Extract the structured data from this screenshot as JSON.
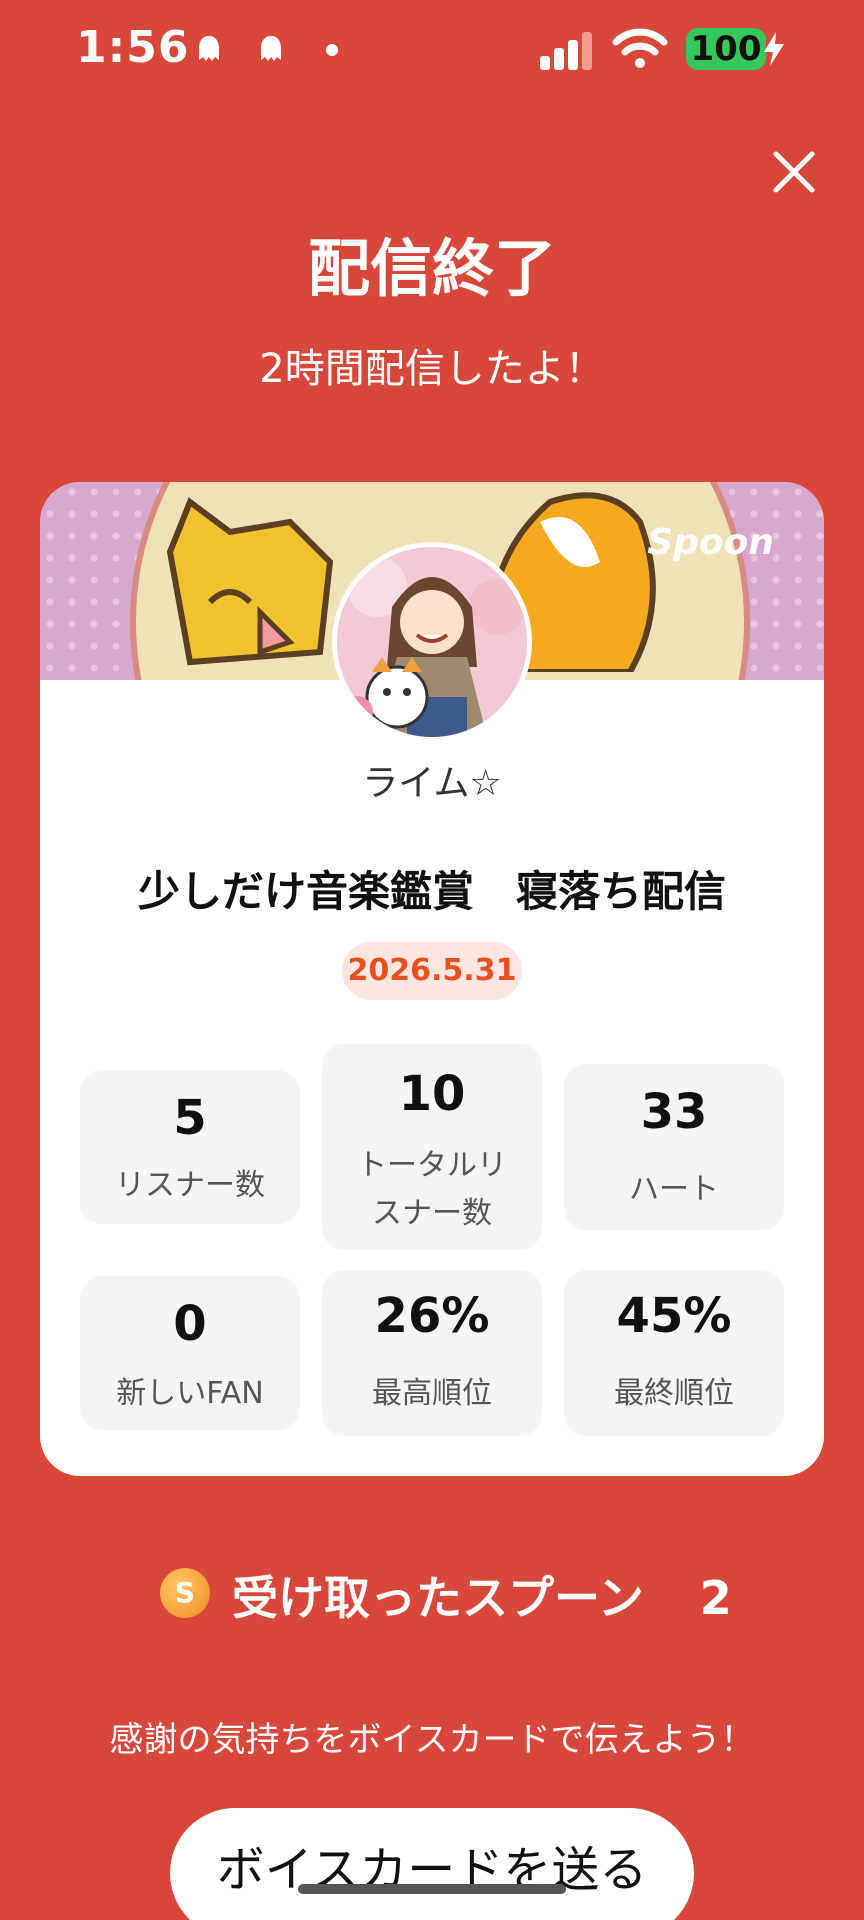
{
  "status_bar": {
    "time": "1:56",
    "battery": "100",
    "icons": [
      "ghost-notification-icon",
      "ghost-notification-icon",
      "dot-icon",
      "signal-icon",
      "wifi-icon",
      "battery-icon",
      "charging-bolt-icon"
    ]
  },
  "header": {
    "title": "配信終了",
    "subtitle": "2時間配信したよ！"
  },
  "card": {
    "brand": "Spoon",
    "username": "ライム☆",
    "broadcast_title": "少しだけ音楽鑑賞　寝落ち配信",
    "date": "2026.5.31",
    "stats": [
      {
        "value": "5",
        "label": "リスナー数"
      },
      {
        "value": "10",
        "label_line1": "トータルリ",
        "label_line2": "スナー数"
      },
      {
        "value": "33",
        "label": "ハート"
      },
      {
        "value": "0",
        "label": "新しいFAN"
      },
      {
        "value": "26%",
        "label": "最高順位"
      },
      {
        "value": "45%",
        "label": "最終順位"
      }
    ]
  },
  "spoons": {
    "coin_letter": "S",
    "label": "受け取ったスプーン",
    "count": "2"
  },
  "thanks_text": "感謝の気持ちをボイスカードで伝えよう！",
  "voice_button_label": "ボイスカードを送る",
  "colors": {
    "background": "#D7473A",
    "date_text": "#E8501F",
    "battery": "#35C759"
  }
}
